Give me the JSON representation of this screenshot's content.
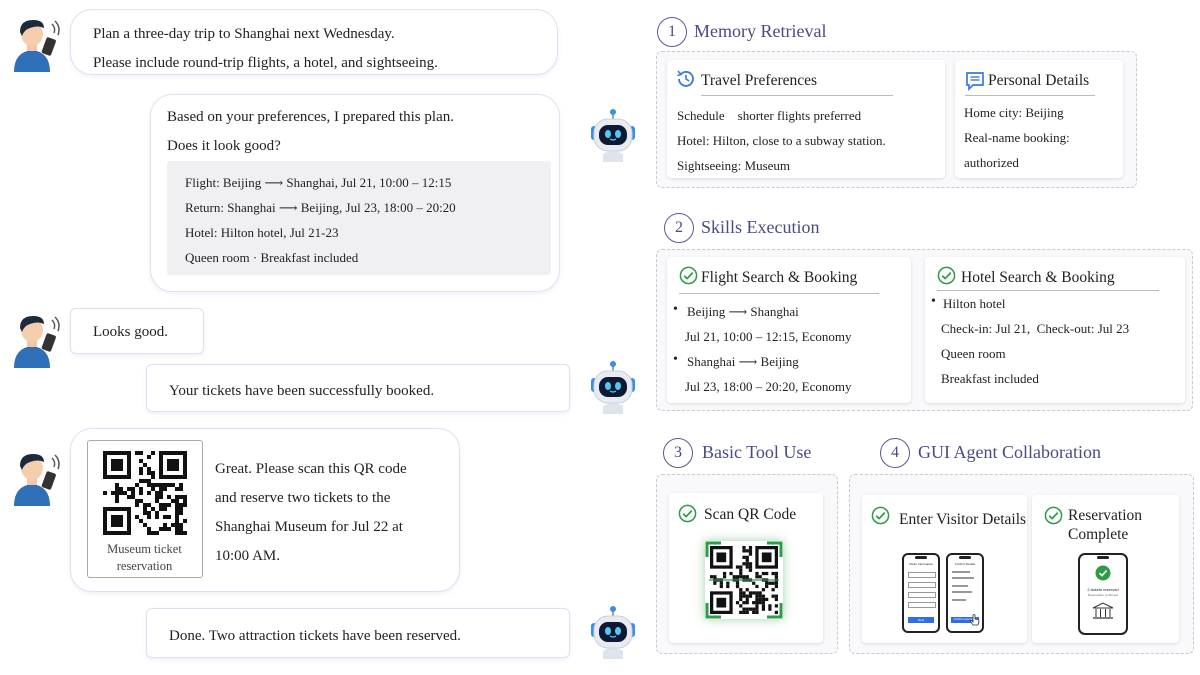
{
  "chat": {
    "user_msg1": [
      "Plan a three-day trip to Shanghai next Wednesday.",
      "Please include round-trip flights, a hotel, and sightseeing."
    ],
    "bot_msg1": [
      "Based on your preferences, I prepared this plan.",
      "Does it look good?"
    ],
    "plan_details": [
      "Flight: Beijing ⟶ Shanghai, Jul 21, 10:00 – 12:15",
      "Return: Shanghai ⟶ Beijing, Jul 23, 18:00 – 20:20",
      "Hotel: Hilton hotel, Jul 21-23",
      "Queen room · Breakfast included"
    ],
    "user_msg2": "Looks good.",
    "bot_msg2": "Your tickets have been successfully booked.",
    "user_msg3": [
      "Great. Please scan this QR code",
      "and reserve two tickets to the",
      "Shanghai Museum for Jul 22 at",
      "10:00 AM."
    ],
    "qr_caption": [
      "Museum ticket",
      "reservation"
    ],
    "bot_msg3": "Done. Two attraction tickets have been reserved."
  },
  "memory": {
    "num": "1",
    "title": "Memory Retrieval",
    "prefs_title": "Travel Preferences",
    "prefs": [
      "Schedule    shorter flights preferred",
      "Hotel: Hilton, close to a subway station.",
      "Sightseeing: Museum"
    ],
    "personal_title": "Personal Details",
    "personal": [
      "Home city: Beijing",
      "Real-name booking:",
      "authorized"
    ]
  },
  "skills": {
    "num": "2",
    "title": "Skills Execution",
    "flight_title": "Flight Search & Booking",
    "flight": [
      "Beijing ⟶ Shanghai",
      "Jul 21, 10:00 – 12:15, Economy",
      "Shanghai ⟶ Beijing",
      "Jul 23, 18:00 – 20:20, Economy"
    ],
    "hotel_title": "Hotel Search & Booking",
    "hotel": [
      "Hilton hotel",
      "Check-in: Jul 21,  Check-out: Jul 23",
      "Queen room",
      "Breakfast included"
    ]
  },
  "tools": {
    "num": "3",
    "title": "Basic Tool Use",
    "scan_title": "Scan QR Code"
  },
  "gui": {
    "num": "4",
    "title": "GUI Agent Collaboration",
    "visitor_title": "Enter Visitor Details",
    "reservation_title": [
      "Reservation",
      "Complete"
    ],
    "phone_header_a": "Visitor Information",
    "phone_header_b": "Confirm Details",
    "phone_button_a": "Next",
    "phone_button_b": "Confirm reservation",
    "reserved_text": "2 tickets reserved",
    "reserved_sub": "Reservation confirmed"
  },
  "colors": {
    "accent": "#4a4a86",
    "check": "#2e9b46",
    "bubble_border": "#dde1f3"
  }
}
